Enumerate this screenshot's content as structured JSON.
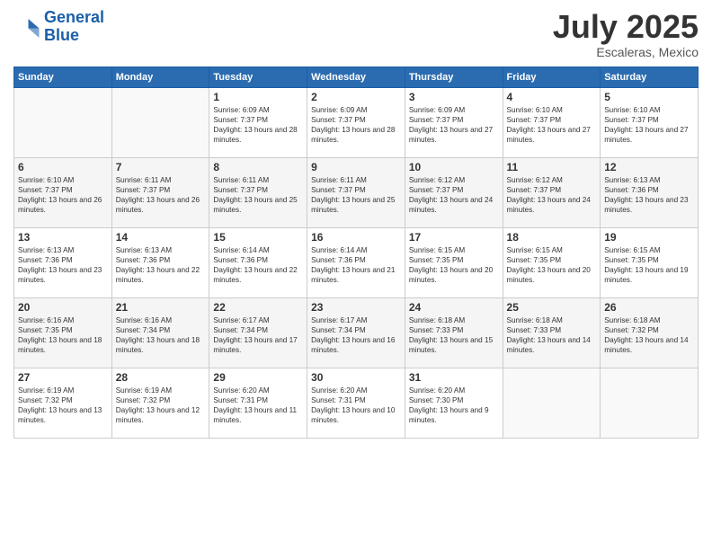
{
  "header": {
    "logo_line1": "General",
    "logo_line2": "Blue",
    "month": "July 2025",
    "location": "Escaleras, Mexico"
  },
  "days_of_week": [
    "Sunday",
    "Monday",
    "Tuesday",
    "Wednesday",
    "Thursday",
    "Friday",
    "Saturday"
  ],
  "weeks": [
    [
      {
        "num": "",
        "sunrise": "",
        "sunset": "",
        "daylight": ""
      },
      {
        "num": "",
        "sunrise": "",
        "sunset": "",
        "daylight": ""
      },
      {
        "num": "1",
        "sunrise": "Sunrise: 6:09 AM",
        "sunset": "Sunset: 7:37 PM",
        "daylight": "Daylight: 13 hours and 28 minutes."
      },
      {
        "num": "2",
        "sunrise": "Sunrise: 6:09 AM",
        "sunset": "Sunset: 7:37 PM",
        "daylight": "Daylight: 13 hours and 28 minutes."
      },
      {
        "num": "3",
        "sunrise": "Sunrise: 6:09 AM",
        "sunset": "Sunset: 7:37 PM",
        "daylight": "Daylight: 13 hours and 27 minutes."
      },
      {
        "num": "4",
        "sunrise": "Sunrise: 6:10 AM",
        "sunset": "Sunset: 7:37 PM",
        "daylight": "Daylight: 13 hours and 27 minutes."
      },
      {
        "num": "5",
        "sunrise": "Sunrise: 6:10 AM",
        "sunset": "Sunset: 7:37 PM",
        "daylight": "Daylight: 13 hours and 27 minutes."
      }
    ],
    [
      {
        "num": "6",
        "sunrise": "Sunrise: 6:10 AM",
        "sunset": "Sunset: 7:37 PM",
        "daylight": "Daylight: 13 hours and 26 minutes."
      },
      {
        "num": "7",
        "sunrise": "Sunrise: 6:11 AM",
        "sunset": "Sunset: 7:37 PM",
        "daylight": "Daylight: 13 hours and 26 minutes."
      },
      {
        "num": "8",
        "sunrise": "Sunrise: 6:11 AM",
        "sunset": "Sunset: 7:37 PM",
        "daylight": "Daylight: 13 hours and 25 minutes."
      },
      {
        "num": "9",
        "sunrise": "Sunrise: 6:11 AM",
        "sunset": "Sunset: 7:37 PM",
        "daylight": "Daylight: 13 hours and 25 minutes."
      },
      {
        "num": "10",
        "sunrise": "Sunrise: 6:12 AM",
        "sunset": "Sunset: 7:37 PM",
        "daylight": "Daylight: 13 hours and 24 minutes."
      },
      {
        "num": "11",
        "sunrise": "Sunrise: 6:12 AM",
        "sunset": "Sunset: 7:37 PM",
        "daylight": "Daylight: 13 hours and 24 minutes."
      },
      {
        "num": "12",
        "sunrise": "Sunrise: 6:13 AM",
        "sunset": "Sunset: 7:36 PM",
        "daylight": "Daylight: 13 hours and 23 minutes."
      }
    ],
    [
      {
        "num": "13",
        "sunrise": "Sunrise: 6:13 AM",
        "sunset": "Sunset: 7:36 PM",
        "daylight": "Daylight: 13 hours and 23 minutes."
      },
      {
        "num": "14",
        "sunrise": "Sunrise: 6:13 AM",
        "sunset": "Sunset: 7:36 PM",
        "daylight": "Daylight: 13 hours and 22 minutes."
      },
      {
        "num": "15",
        "sunrise": "Sunrise: 6:14 AM",
        "sunset": "Sunset: 7:36 PM",
        "daylight": "Daylight: 13 hours and 22 minutes."
      },
      {
        "num": "16",
        "sunrise": "Sunrise: 6:14 AM",
        "sunset": "Sunset: 7:36 PM",
        "daylight": "Daylight: 13 hours and 21 minutes."
      },
      {
        "num": "17",
        "sunrise": "Sunrise: 6:15 AM",
        "sunset": "Sunset: 7:35 PM",
        "daylight": "Daylight: 13 hours and 20 minutes."
      },
      {
        "num": "18",
        "sunrise": "Sunrise: 6:15 AM",
        "sunset": "Sunset: 7:35 PM",
        "daylight": "Daylight: 13 hours and 20 minutes."
      },
      {
        "num": "19",
        "sunrise": "Sunrise: 6:15 AM",
        "sunset": "Sunset: 7:35 PM",
        "daylight": "Daylight: 13 hours and 19 minutes."
      }
    ],
    [
      {
        "num": "20",
        "sunrise": "Sunrise: 6:16 AM",
        "sunset": "Sunset: 7:35 PM",
        "daylight": "Daylight: 13 hours and 18 minutes."
      },
      {
        "num": "21",
        "sunrise": "Sunrise: 6:16 AM",
        "sunset": "Sunset: 7:34 PM",
        "daylight": "Daylight: 13 hours and 18 minutes."
      },
      {
        "num": "22",
        "sunrise": "Sunrise: 6:17 AM",
        "sunset": "Sunset: 7:34 PM",
        "daylight": "Daylight: 13 hours and 17 minutes."
      },
      {
        "num": "23",
        "sunrise": "Sunrise: 6:17 AM",
        "sunset": "Sunset: 7:34 PM",
        "daylight": "Daylight: 13 hours and 16 minutes."
      },
      {
        "num": "24",
        "sunrise": "Sunrise: 6:18 AM",
        "sunset": "Sunset: 7:33 PM",
        "daylight": "Daylight: 13 hours and 15 minutes."
      },
      {
        "num": "25",
        "sunrise": "Sunrise: 6:18 AM",
        "sunset": "Sunset: 7:33 PM",
        "daylight": "Daylight: 13 hours and 14 minutes."
      },
      {
        "num": "26",
        "sunrise": "Sunrise: 6:18 AM",
        "sunset": "Sunset: 7:32 PM",
        "daylight": "Daylight: 13 hours and 14 minutes."
      }
    ],
    [
      {
        "num": "27",
        "sunrise": "Sunrise: 6:19 AM",
        "sunset": "Sunset: 7:32 PM",
        "daylight": "Daylight: 13 hours and 13 minutes."
      },
      {
        "num": "28",
        "sunrise": "Sunrise: 6:19 AM",
        "sunset": "Sunset: 7:32 PM",
        "daylight": "Daylight: 13 hours and 12 minutes."
      },
      {
        "num": "29",
        "sunrise": "Sunrise: 6:20 AM",
        "sunset": "Sunset: 7:31 PM",
        "daylight": "Daylight: 13 hours and 11 minutes."
      },
      {
        "num": "30",
        "sunrise": "Sunrise: 6:20 AM",
        "sunset": "Sunset: 7:31 PM",
        "daylight": "Daylight: 13 hours and 10 minutes."
      },
      {
        "num": "31",
        "sunrise": "Sunrise: 6:20 AM",
        "sunset": "Sunset: 7:30 PM",
        "daylight": "Daylight: 13 hours and 9 minutes."
      },
      {
        "num": "",
        "sunrise": "",
        "sunset": "",
        "daylight": ""
      },
      {
        "num": "",
        "sunrise": "",
        "sunset": "",
        "daylight": ""
      }
    ]
  ]
}
